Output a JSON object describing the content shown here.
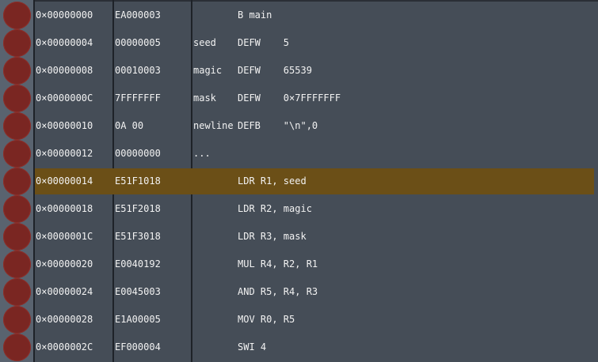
{
  "listing": {
    "highlight_color": "#6b4f17",
    "breakpoint_color": "#7a2622",
    "rows": [
      {
        "addr": "0×00000000",
        "hex": "EA000003",
        "label": "",
        "instr": "B main",
        "highlight": false
      },
      {
        "addr": "0×00000004",
        "hex": "00000005",
        "label": "seed",
        "instr": "DEFW    5",
        "highlight": false
      },
      {
        "addr": "0×00000008",
        "hex": "00010003",
        "label": "magic",
        "instr": "DEFW    65539",
        "highlight": false
      },
      {
        "addr": "0×0000000C",
        "hex": "7FFFFFFF",
        "label": "mask",
        "instr": "DEFW    0×7FFFFFFF",
        "highlight": false
      },
      {
        "addr": "0×00000010",
        "hex": "0A 00",
        "label": "newline",
        "instr": "DEFB    \"\\n\",0",
        "highlight": false
      },
      {
        "addr": "0×00000012",
        "hex": "00000000",
        "label": "...",
        "instr": "",
        "highlight": false
      },
      {
        "addr": "0×00000014",
        "hex": "E51F1018",
        "label": "",
        "instr": "LDR R1, seed",
        "highlight": true
      },
      {
        "addr": "0×00000018",
        "hex": "E51F2018",
        "label": "",
        "instr": "LDR R2, magic",
        "highlight": false
      },
      {
        "addr": "0×0000001C",
        "hex": "E51F3018",
        "label": "",
        "instr": "LDR R3, mask",
        "highlight": false
      },
      {
        "addr": "0×00000020",
        "hex": "E0040192",
        "label": "",
        "instr": "MUL R4, R2, R1",
        "highlight": false
      },
      {
        "addr": "0×00000024",
        "hex": "E0045003",
        "label": "",
        "instr": "AND R5, R4, R3",
        "highlight": false
      },
      {
        "addr": "0×00000028",
        "hex": "E1A00005",
        "label": "",
        "instr": "MOV R0, R5",
        "highlight": false
      },
      {
        "addr": "0×0000002C",
        "hex": "EF000004",
        "label": "",
        "instr": "SWI 4",
        "highlight": false
      }
    ]
  }
}
